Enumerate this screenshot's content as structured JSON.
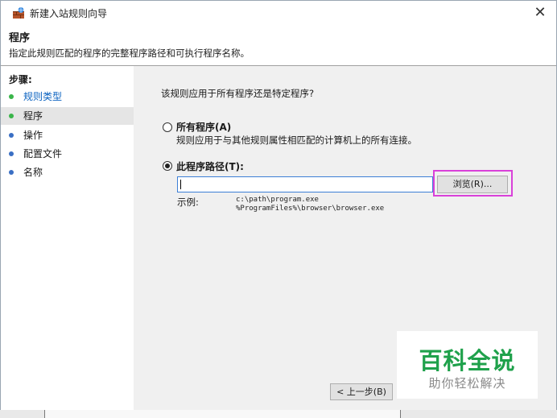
{
  "window": {
    "title": "新建入站规则向导",
    "close_glyph": "✕"
  },
  "header": {
    "title": "程序",
    "description": "指定此规则匹配的程序的完整程序路径和可执行程序名称。"
  },
  "steps": {
    "title": "步骤:",
    "items": [
      {
        "label": "规则类型",
        "state": "link"
      },
      {
        "label": "程序",
        "state": "current"
      },
      {
        "label": "操作",
        "state": "normal"
      },
      {
        "label": "配置文件",
        "state": "normal"
      },
      {
        "label": "名称",
        "state": "normal"
      }
    ]
  },
  "main": {
    "question": "该规则应用于所有程序还是特定程序?",
    "option_all": {
      "label": "所有程序(A)",
      "description": "规则应用于与其他规则属性相匹配的计算机上的所有连接。",
      "selected": false
    },
    "option_path": {
      "label": "此程序路径(T):",
      "selected": true,
      "value": ""
    },
    "browse_label": "浏览(R)...",
    "example_label": "示例:",
    "example_lines": [
      "c:\\path\\program.exe",
      "%ProgramFiles%\\browser\\browser.exe"
    ],
    "back_label": "< 上一步(B)"
  },
  "watermark": {
    "title": "百科全说",
    "subtitle": "助你轻松解决"
  },
  "colors": {
    "link": "#0a62c0",
    "highlight": "#d941d9",
    "watermark": "#1fa14b"
  }
}
